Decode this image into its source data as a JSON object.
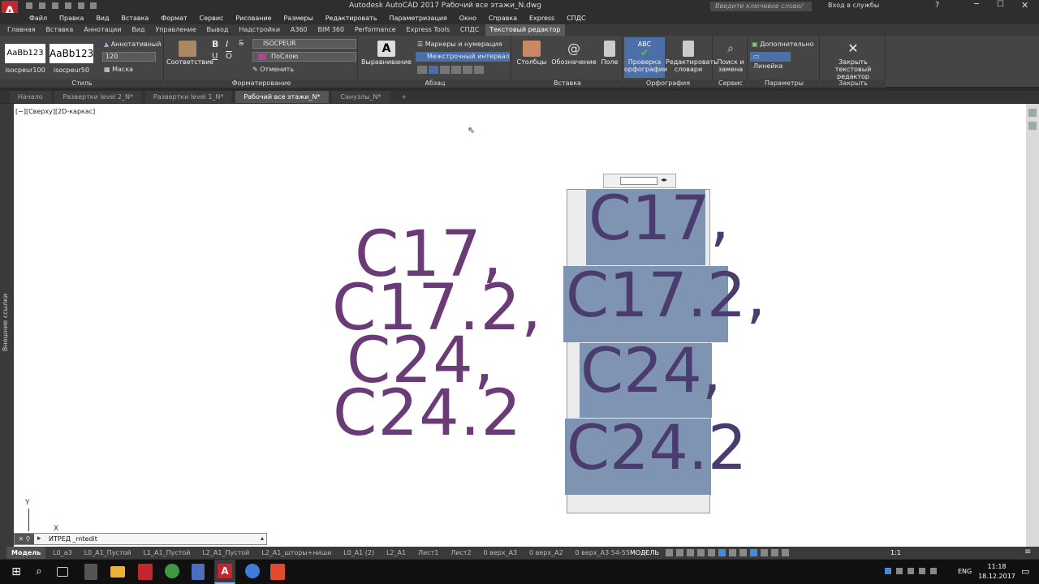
{
  "titlebar": {
    "title": "Autodesk AutoCAD 2017    Рабочий все этажи_N.dwg",
    "search_placeholder": "Введите ключевое слово/фразу",
    "signin": "Вход в службы"
  },
  "menu": [
    "Файл",
    "Правка",
    "Вид",
    "Вставка",
    "Формат",
    "Сервис",
    "Рисование",
    "Размеры",
    "Редактировать",
    "Параметризация",
    "Окно",
    "Справка",
    "Express",
    "СПДС"
  ],
  "ribbon_tabs": [
    "Главная",
    "Вставка",
    "Аннотации",
    "Вид",
    "Управление",
    "Вывод",
    "Надстройки",
    "A360",
    "BIM 360",
    "Performance",
    "Express Tools",
    "СПДС",
    "Текстовый редактор"
  ],
  "ribbon": {
    "style": {
      "sample1": "AaBb123",
      "sample1_name": "isocpeur100",
      "sample2": "AaBb123",
      "sample2_name": "isocpeur50",
      "annotative": "Аннотативный",
      "height": "120",
      "mask": "Маска",
      "label": "Стиль"
    },
    "format": {
      "match": "Соответствие",
      "font": "ISOCPEUR",
      "color": "ПоСлою",
      "undo": "Отменить",
      "bold": "B",
      "italic": "I",
      "strike": "S",
      "underline": "U",
      "overline": "O",
      "label": "Форматирование"
    },
    "paragraph": {
      "align": "Выравнивание",
      "markers": "Маркеры и нумерация",
      "spacing": "Межстрочный интервал",
      "label": "Абзац"
    },
    "insert": {
      "columns": "Столбцы",
      "symbol": "Обозначение",
      "field": "Поле",
      "label": "Вставка"
    },
    "spelling": {
      "check": "Проверка орфографии",
      "dict": "Редактировать словари",
      "abc": "ABC",
      "label": "Орфография"
    },
    "tools": {
      "find": "Поиск и замена",
      "label": "Сервис"
    },
    "options": {
      "more": "Дополнительно",
      "ruler": "Линейка",
      "label": "Параметры"
    },
    "close": {
      "text": "Закрыть текстовый редактор",
      "label": "Закрыть"
    }
  },
  "doc_tabs": [
    "Начало",
    "Развертки level 2_N*",
    "Развертки level 1_N*",
    "Рабочий все этажи_N*",
    "Санузлы_N*"
  ],
  "viewport_label": "[−][Сверху][2D-каркас]",
  "side_label": "Внешние ссылки",
  "drawing_text": [
    "C17,",
    "C17.2,",
    "C24,",
    "C24.2"
  ],
  "edit_text": [
    "C17,",
    "C17.2,",
    "C24,",
    "C24.2"
  ],
  "command": {
    "text": "ИТРЕД _mtedit"
  },
  "ucs": {
    "y": "Y",
    "x": "X"
  },
  "layout_tabs": [
    "Модель",
    "L0_a3",
    "L0_A1_Пустой",
    "L1_A1_Пустой",
    "L2_A1_Пустой",
    "L2_A1_шторы+ниши",
    "L0_A1 (2)",
    "L2_A1",
    "Лист1",
    "Лист2",
    "0 верх_А3",
    "0 верх_А2",
    "0 верх_А3 54-55"
  ],
  "status": {
    "model": "МОДЕЛЬ",
    "scale": "1:1"
  },
  "taskbar": {
    "lang": "ENG",
    "time": "11:18",
    "date": "18.12.2017"
  }
}
